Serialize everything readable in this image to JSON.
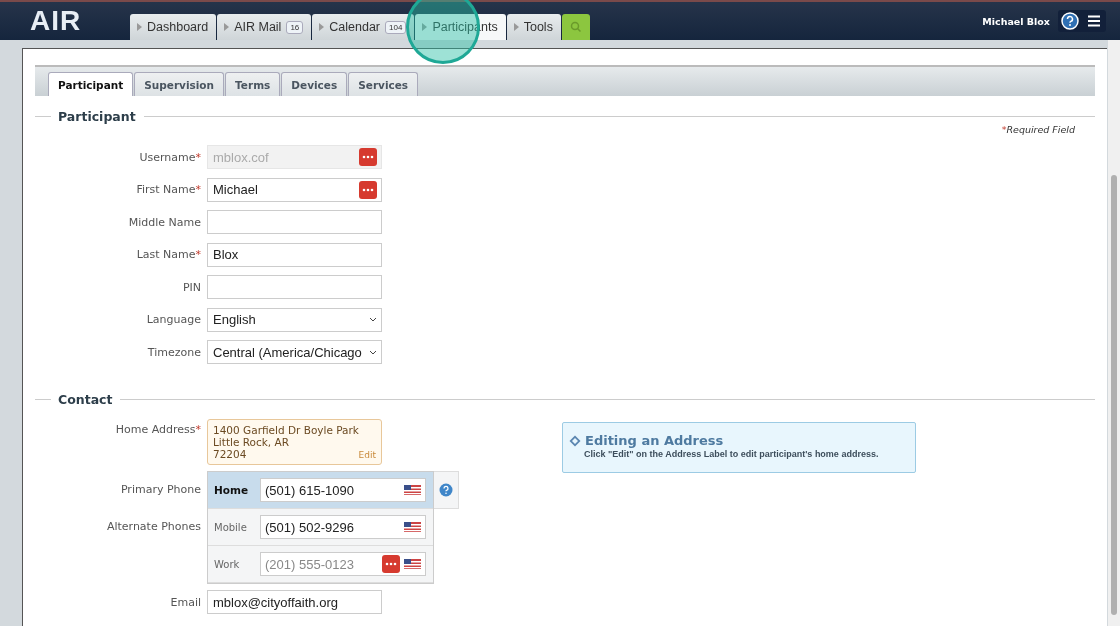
{
  "header": {
    "logo": "AIR",
    "user": "Michael Blox",
    "nav": [
      {
        "label": "Dashboard",
        "selected": false
      },
      {
        "label": "AIR Mail",
        "badge": "16",
        "selected": false
      },
      {
        "label": "Calendar",
        "badge": "104",
        "selected": false
      },
      {
        "label": "Participants",
        "selected": true
      },
      {
        "label": "Tools",
        "selected": false
      }
    ]
  },
  "tabs": [
    {
      "label": "Participant",
      "selected": true
    },
    {
      "label": "Supervision",
      "selected": false
    },
    {
      "label": "Terms",
      "selected": false
    },
    {
      "label": "Devices",
      "selected": false
    },
    {
      "label": "Services",
      "selected": false
    }
  ],
  "participant": {
    "title": "Participant",
    "required_mark": "*",
    "required_note": "Required Field",
    "fields": [
      {
        "label": "Username",
        "required_mark": "*",
        "kind": "text",
        "value": "mblox.cof",
        "disabled": true,
        "action": true
      },
      {
        "label": "First Name",
        "required_mark": "*",
        "kind": "text",
        "value": "Michael",
        "disabled": false,
        "action": true
      },
      {
        "label": "Middle Name",
        "kind": "text",
        "disabled": false,
        "action": false
      },
      {
        "label": "Last Name",
        "required_mark": "*",
        "kind": "text",
        "value": "Blox",
        "disabled": false,
        "action": false
      },
      {
        "label": "PIN",
        "kind": "text",
        "disabled": false,
        "action": false
      },
      {
        "label": "Language",
        "kind": "select",
        "value": "English",
        "disabled": false,
        "action": false
      },
      {
        "label": "Timezone",
        "kind": "select",
        "value": "Central (America/Chicago",
        "disabled": false,
        "action": false
      }
    ]
  },
  "contact": {
    "title": "Contact",
    "address": {
      "label": "Home Address",
      "required_mark": "*",
      "lines": [
        "1400 Garfield Dr Boyle Park",
        "Little Rock, AR",
        "72204"
      ],
      "edit": "Edit"
    },
    "phones": [
      {
        "group": "Primary Phone",
        "type": "Home",
        "value": "(501) 615-1090",
        "primary": true,
        "action": false
      },
      {
        "group": "Alternate Phones",
        "type": "Mobile",
        "value": "(501) 502-9296",
        "primary": false,
        "action": false
      },
      {
        "type": "Work",
        "placeholder": "(201) 555-0123",
        "primary": false,
        "action": true
      }
    ],
    "email": {
      "label": "Email",
      "value": "mblox@cityoffaith.org"
    },
    "info": {
      "title": "Editing an Address",
      "text": "Click \"Edit\" on the Address Label to edit participant's home address."
    }
  }
}
